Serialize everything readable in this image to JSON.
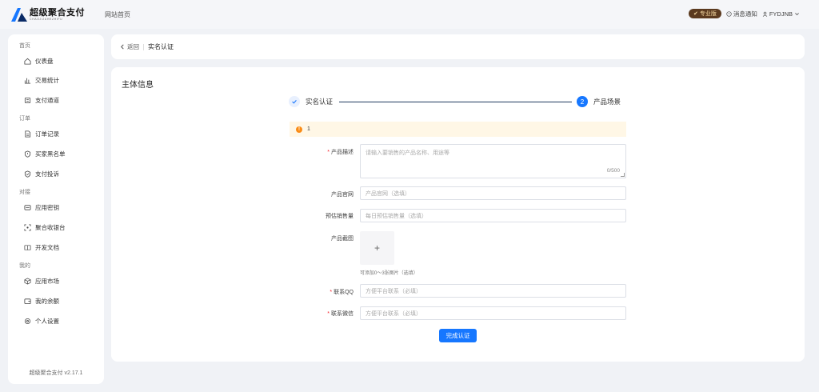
{
  "app": {
    "logo_title": "超级聚合支付",
    "logo_subtitle": "CHAOJIJUHEZHIFU",
    "home_link": "网站首页"
  },
  "topbar": {
    "pro_badge": "专业版",
    "notifications": "消息通知",
    "username": "FYDJNB"
  },
  "sidebar": {
    "groups": [
      {
        "title": "首页",
        "items": [
          {
            "label": "仪表盘",
            "icon": "home-icon"
          },
          {
            "label": "交易统计",
            "icon": "bar-chart-icon"
          },
          {
            "label": "支付通道",
            "icon": "payment-icon"
          }
        ]
      },
      {
        "title": "订单",
        "items": [
          {
            "label": "订单记录",
            "icon": "document-icon"
          },
          {
            "label": "买家黑名单",
            "icon": "shield-alert-icon"
          },
          {
            "label": "支付投诉",
            "icon": "shield-complaint-icon"
          }
        ]
      },
      {
        "title": "对接",
        "items": [
          {
            "label": "应用密钥",
            "icon": "key-card-icon"
          },
          {
            "label": "聚合收银台",
            "icon": "scan-icon"
          },
          {
            "label": "开发文档",
            "icon": "book-icon"
          }
        ]
      },
      {
        "title": "我的",
        "items": [
          {
            "label": "应用市场",
            "icon": "box-icon"
          },
          {
            "label": "我的余额",
            "icon": "wallet-icon"
          },
          {
            "label": "个人设置",
            "icon": "settings-icon"
          }
        ]
      }
    ],
    "version": "超级聚合支付 v2.17.1"
  },
  "breadcrumb": {
    "back": "返回",
    "current": "实名认证"
  },
  "main": {
    "section_title": "主体信息",
    "steps": [
      {
        "label": "实名认证",
        "status": "done"
      },
      {
        "number": "2",
        "label": "产品场景",
        "status": "active"
      }
    ],
    "alert_text": "1",
    "form": {
      "product_desc_label": "产品描述",
      "product_desc_placeholder": "请输入要销售的产品名称、用途等",
      "product_desc_count": "0/500",
      "website_label": "产品官网",
      "website_placeholder": "产品官网（选填）",
      "sales_label": "预估销售量",
      "sales_placeholder": "每日预估销售量（选填）",
      "screenshot_label": "产品截图",
      "upload_plus": "+",
      "upload_hint": "可添加0～3张图片（选填）",
      "qq_label": "联系QQ",
      "qq_placeholder": "方便平台联系（必填）",
      "wechat_label": "联系微信",
      "wechat_placeholder": "方便平台联系（必填）",
      "submit": "完成认证"
    }
  },
  "colors": {
    "primary": "#1677ff",
    "pro_badge_bg": "#5b3a1f",
    "alert_bg": "#fff7e6",
    "alert_icon": "#fa8c16",
    "required": "#f5222d"
  }
}
